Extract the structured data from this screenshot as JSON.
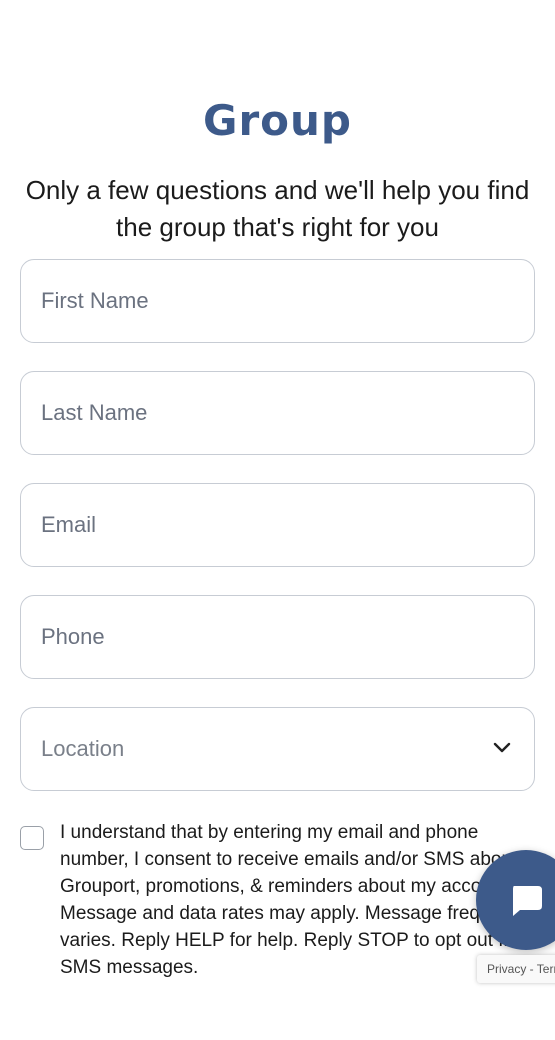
{
  "header": {
    "title": "Group",
    "subtitle": "Only a few questions and we'll help you find the group that's right for you"
  },
  "form": {
    "first_name": {
      "placeholder": "First Name"
    },
    "last_name": {
      "placeholder": "Last Name"
    },
    "email": {
      "placeholder": "Email"
    },
    "phone": {
      "placeholder": "Phone"
    },
    "location": {
      "selected": "Location",
      "icon": "chevron-down-icon"
    },
    "consent_checked": false,
    "consent_text": "I understand that by entering my email and phone number, I consent to receive emails and/or SMS about Grouport, promotions, & reminders about my account. Message and data rates may apply. Message frequency varies. Reply HELP for help. Reply STOP to opt out from SMS messages."
  },
  "widgets": {
    "chat_icon": "chat-bubble-icon",
    "recaptcha_label": "Privacy - Terms"
  },
  "colors": {
    "brand": "#3d5a8a",
    "border": "#c7ccd4",
    "placeholder": "#6b7280"
  }
}
